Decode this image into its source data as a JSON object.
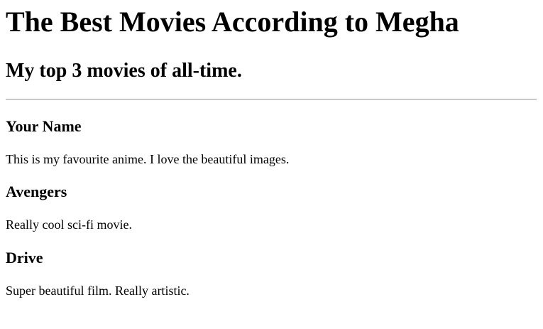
{
  "page": {
    "title": "The Best Movies According to Megha",
    "subtitle": "My top 3 movies of all-time."
  },
  "movies": [
    {
      "name": "Your Name",
      "description": "This is my favourite anime. I love the beautiful images."
    },
    {
      "name": "Avengers",
      "description": "Really cool sci-fi movie."
    },
    {
      "name": "Drive",
      "description": "Super beautiful film. Really artistic."
    }
  ]
}
